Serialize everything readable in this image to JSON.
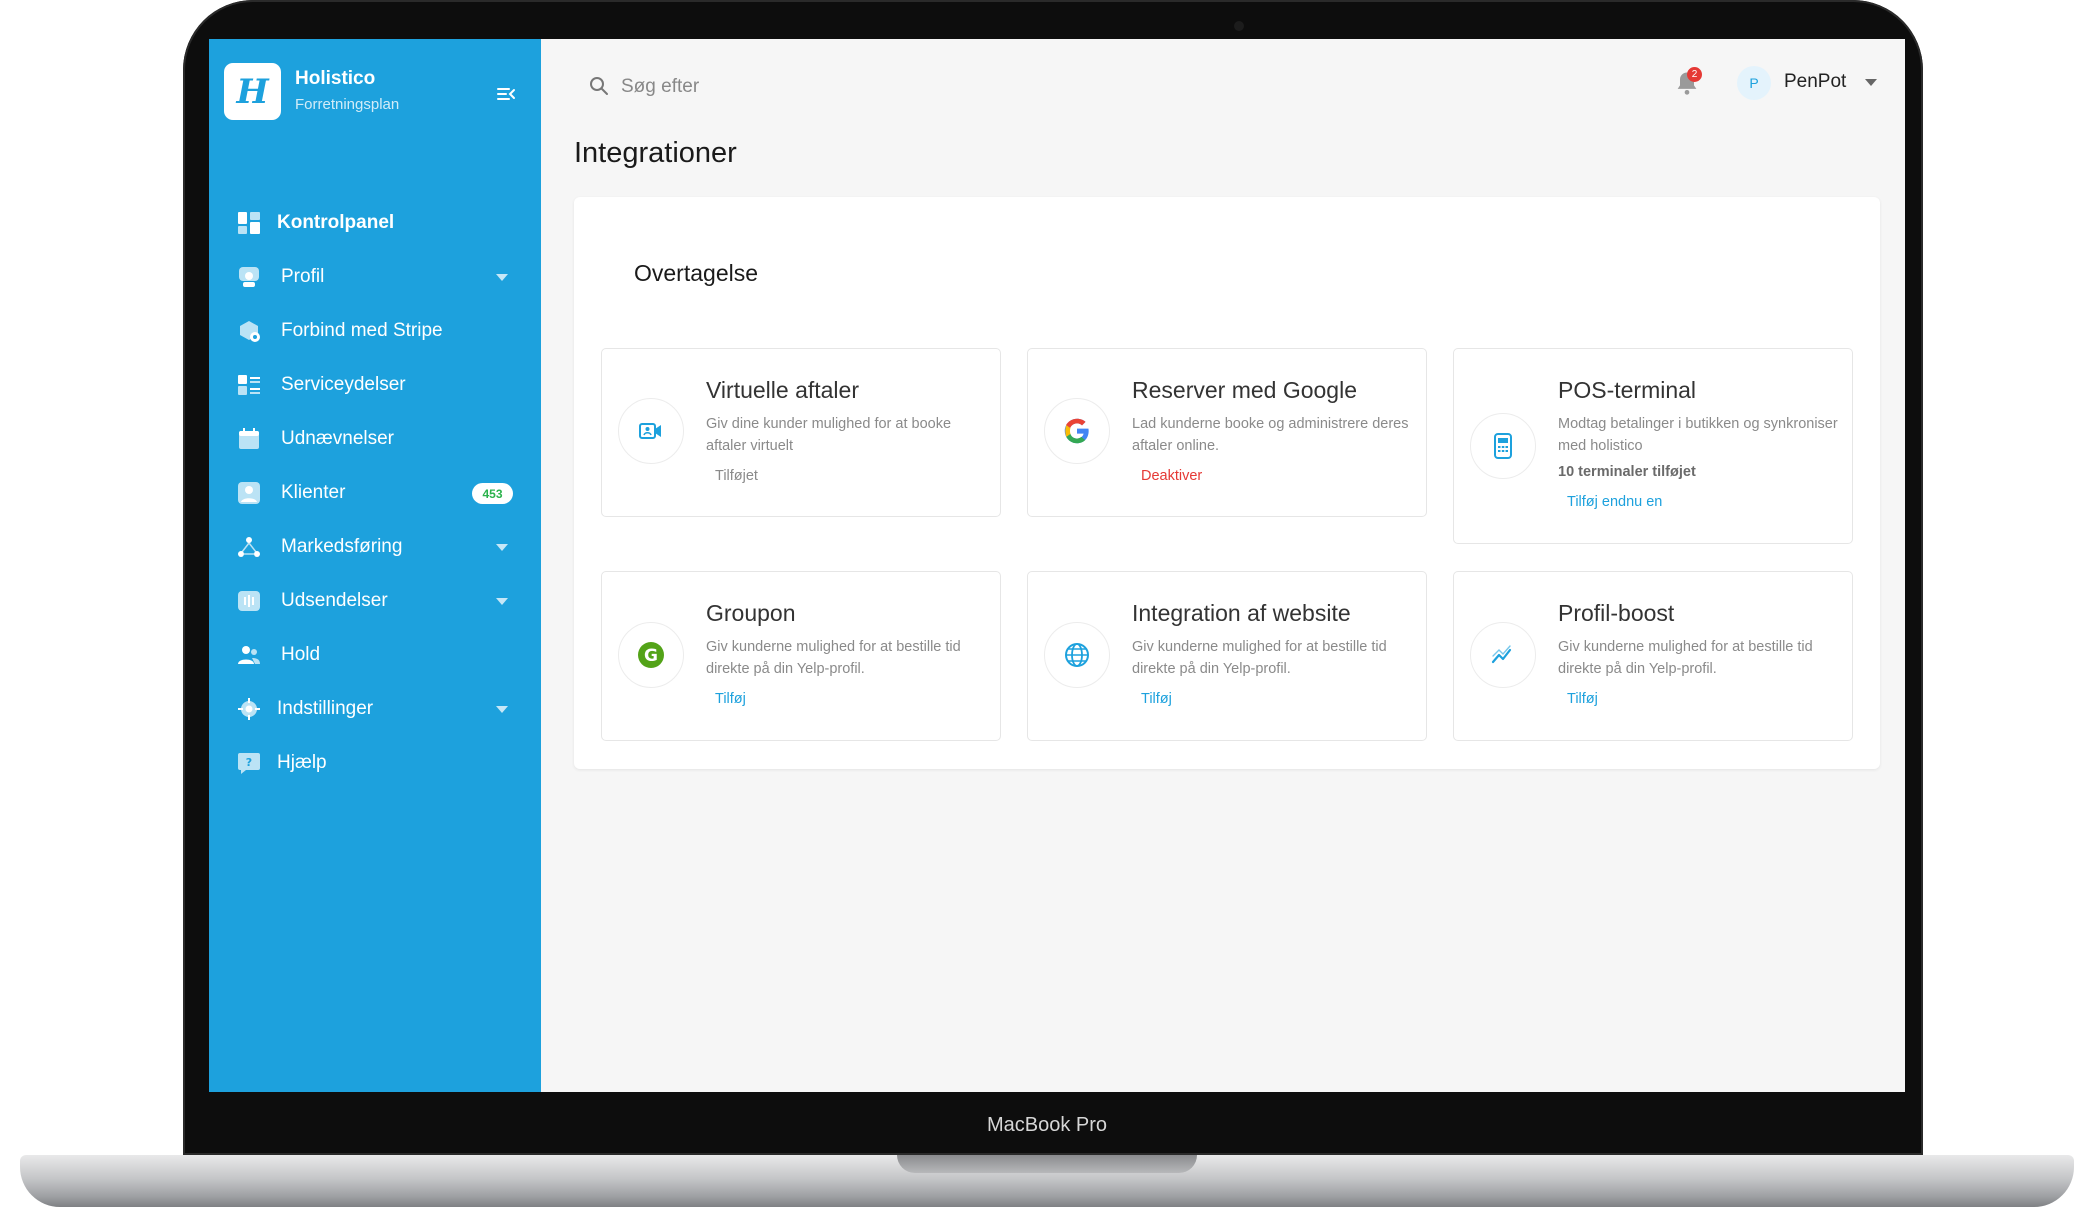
{
  "device": {
    "label": "MacBook Pro"
  },
  "sidebar": {
    "brand_name": "Holistico",
    "brand_plan": "Forretningsplan",
    "items": [
      {
        "label": "Kontrolpanel"
      },
      {
        "label": "Profil"
      },
      {
        "label": "Forbind med Stripe"
      },
      {
        "label": "Serviceydelser"
      },
      {
        "label": "Udnævnelser"
      },
      {
        "label": "Klienter",
        "badge": "453"
      },
      {
        "label": "Markedsføring"
      },
      {
        "label": "Udsendelser"
      },
      {
        "label": "Hold"
      },
      {
        "label": "Indstillinger"
      },
      {
        "label": "Hjælp"
      }
    ]
  },
  "header": {
    "search_placeholder": "Søg efter",
    "notification_count": "2",
    "user_initial": "P",
    "user_name": "PenPot"
  },
  "main": {
    "title": "Integrationer",
    "section_title": "Overtagelse",
    "cards": [
      {
        "title": "Virtuelle aftaler",
        "desc": "Giv dine kunder mulighed for at booke aftaler virtuelt",
        "action": "Tilføjet"
      },
      {
        "title": "Reserver med Google",
        "desc": "Lad kunderne booke og administrere deres aftaler online.",
        "action": "Deaktiver"
      },
      {
        "title": "POS-terminal",
        "desc": "Modtag betalinger i butikken og synkroniser med holistico",
        "extra": "10 terminaler tilføjet",
        "action": "Tilføj endnu en"
      },
      {
        "title": "Groupon",
        "desc": "Giv kunderne mulighed for at bestille tid direkte på din Yelp-profil.",
        "action": "Tilføj"
      },
      {
        "title": "Integration af website",
        "desc": "Giv kunderne mulighed for at bestille tid direkte på din Yelp-profil.",
        "action": "Tilføj"
      },
      {
        "title": "Profil-boost",
        "desc": "Giv kunderne mulighed for at bestille tid direkte på din Yelp-profil.",
        "action": "Tilføj"
      }
    ]
  },
  "colors": {
    "brand": "#1da1dd",
    "link": "#1da1dd",
    "danger": "#e53935",
    "added": "#8a8a8a",
    "groupon": "#53a318"
  }
}
